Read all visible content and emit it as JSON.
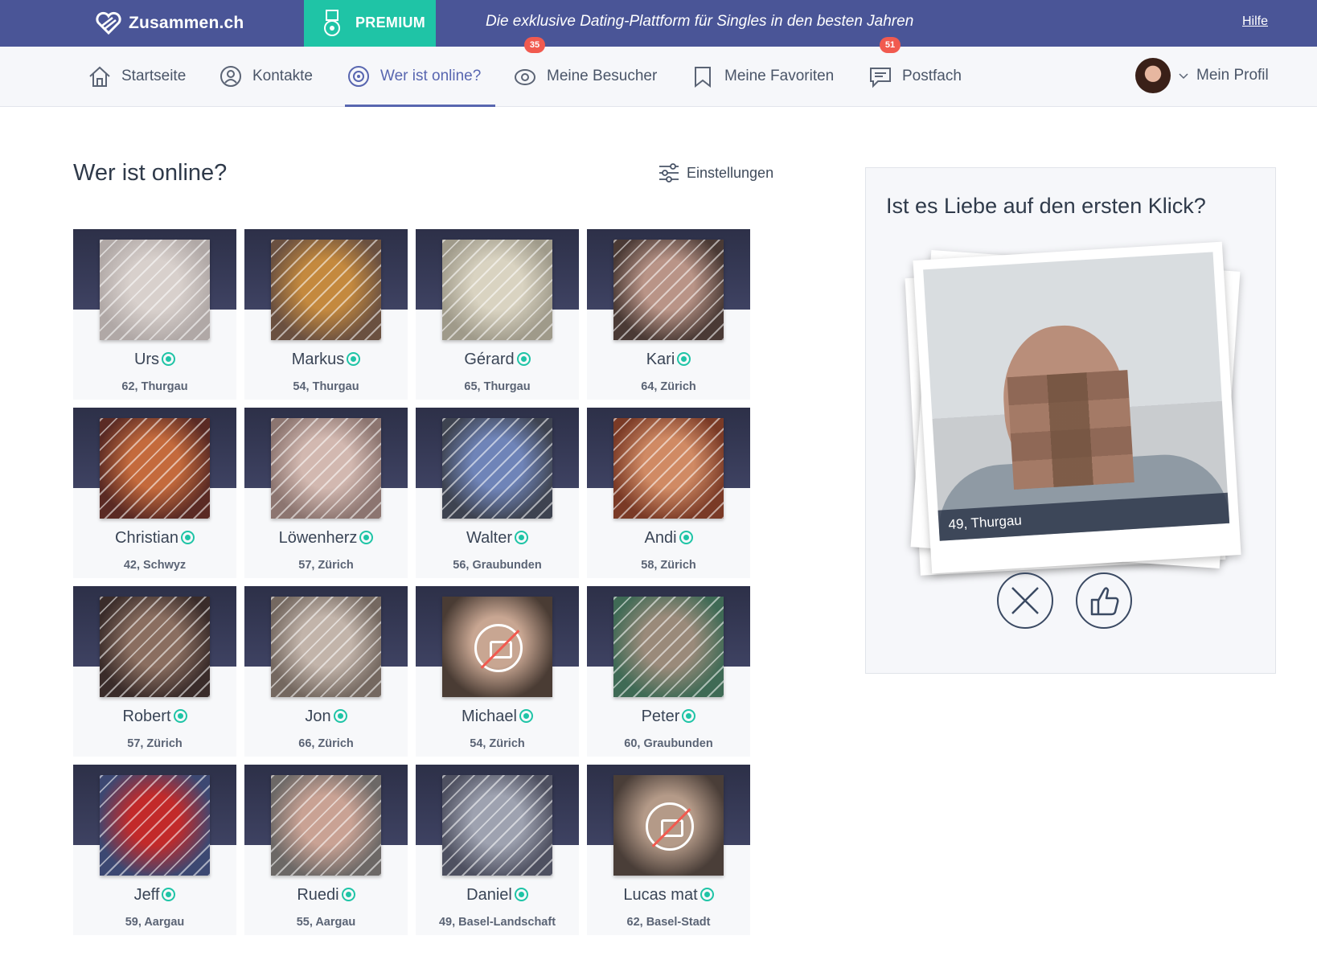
{
  "brand": {
    "name": "Zusammen.ch",
    "premium": "PREMIUM",
    "tagline": "Die exklusive Dating-Plattform für Singles in den besten Jahren",
    "help": "Hilfe"
  },
  "nav": {
    "items": [
      {
        "label": "Startseite",
        "icon": "home-icon"
      },
      {
        "label": "Kontakte",
        "icon": "user-circle-icon"
      },
      {
        "label": "Wer ist online?",
        "icon": "online-icon",
        "active": true
      },
      {
        "label": "Meine Besucher",
        "icon": "eye-icon",
        "badge": "35"
      },
      {
        "label": "Meine Favoriten",
        "icon": "bookmark-icon"
      },
      {
        "label": "Postfach",
        "icon": "message-icon",
        "badge": "51"
      }
    ],
    "profile": "Mein Profil"
  },
  "main": {
    "title": "Wer ist online?",
    "settings": "Einstellungen",
    "members": [
      {
        "name": "Urs",
        "meta": "62, Thurgau",
        "photo": [
          "#b0a8a6",
          "#d8d0cc"
        ]
      },
      {
        "name": "Markus",
        "meta": "54, Thurgau",
        "photo": [
          "#6a5040",
          "#c4893e"
        ]
      },
      {
        "name": "Gérard",
        "meta": "65, Thurgau",
        "photo": [
          "#9f9a8a",
          "#d9d3c1"
        ]
      },
      {
        "name": "Kari",
        "meta": "64, Zürich",
        "photo": [
          "#4a3a35",
          "#b99487"
        ]
      },
      {
        "name": "Christian",
        "meta": "42, Schwyz",
        "photo": [
          "#5a2a24",
          "#c46a3c"
        ]
      },
      {
        "name": "Löwenherz",
        "meta": "57, Zürich",
        "photo": [
          "#8c7570",
          "#d2b8b0"
        ]
      },
      {
        "name": "Walter",
        "meta": "56, Graubunden",
        "photo": [
          "#3e4350",
          "#6f84b8"
        ]
      },
      {
        "name": "Andi",
        "meta": "58, Zürich",
        "photo": [
          "#7a3a26",
          "#d08a64"
        ]
      },
      {
        "name": "Robert",
        "meta": "57, Zürich",
        "photo": [
          "#3a2c2a",
          "#8a6e60"
        ]
      },
      {
        "name": "Jon",
        "meta": "66, Zürich",
        "photo": [
          "#746860",
          "#c2b4aa"
        ]
      },
      {
        "name": "Michael",
        "meta": "54, Zürich",
        "photo": [
          "#4a3c34",
          "#c8a692"
        ],
        "no_photo": true
      },
      {
        "name": "Peter",
        "meta": "60, Graubunden",
        "photo": [
          "#3f6a55",
          "#9a8a7a"
        ]
      },
      {
        "name": "Jeff",
        "meta": "59, Aargau",
        "photo": [
          "#3c4872",
          "#c22a2a"
        ]
      },
      {
        "name": "Ruedi",
        "meta": "55, Aargau",
        "photo": [
          "#6c6866",
          "#c9a294"
        ]
      },
      {
        "name": "Daniel",
        "meta": "49, Basel-Landschaft",
        "photo": [
          "#4e5060",
          "#9ea2b0"
        ]
      },
      {
        "name": "Lucas mat",
        "meta": "62, Basel-Stadt",
        "photo": [
          "#4a3e38",
          "#b49a88"
        ],
        "no_photo": true
      }
    ]
  },
  "sidebar": {
    "title": "Ist es Liebe auf den ersten Klick?",
    "card_caption": "49, Thurgau",
    "no_label": "Nein",
    "yes_label": "Gefällt mir"
  },
  "colors": {
    "topbar": "#4a5597",
    "premium": "#1fc4a6",
    "accent": "#5866b0",
    "online": "#1fc4a6",
    "badge": "#f15a4f"
  }
}
